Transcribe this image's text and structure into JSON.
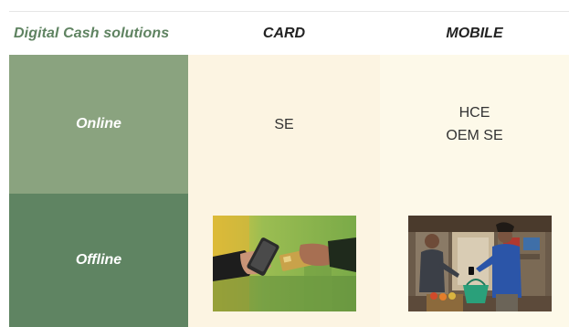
{
  "header": {
    "title": "Digital Cash solutions",
    "col_card": "CARD",
    "col_mobile": "MOBILE"
  },
  "rows": {
    "online": "Online",
    "offline": "Offline"
  },
  "cells": {
    "online_card": "SE",
    "online_mobile_1": "HCE",
    "online_mobile_2": "OEM SE"
  },
  "images": {
    "offline_card": "card-handover-photo",
    "offline_mobile": "market-payment-photo"
  },
  "colors": {
    "title_green": "#5f8361",
    "online_bg": "#8aa37f",
    "offline_bg": "#5f8462",
    "card_col_bg": "#fcf4e2",
    "mobile_col_bg": "#fdf9e9"
  }
}
